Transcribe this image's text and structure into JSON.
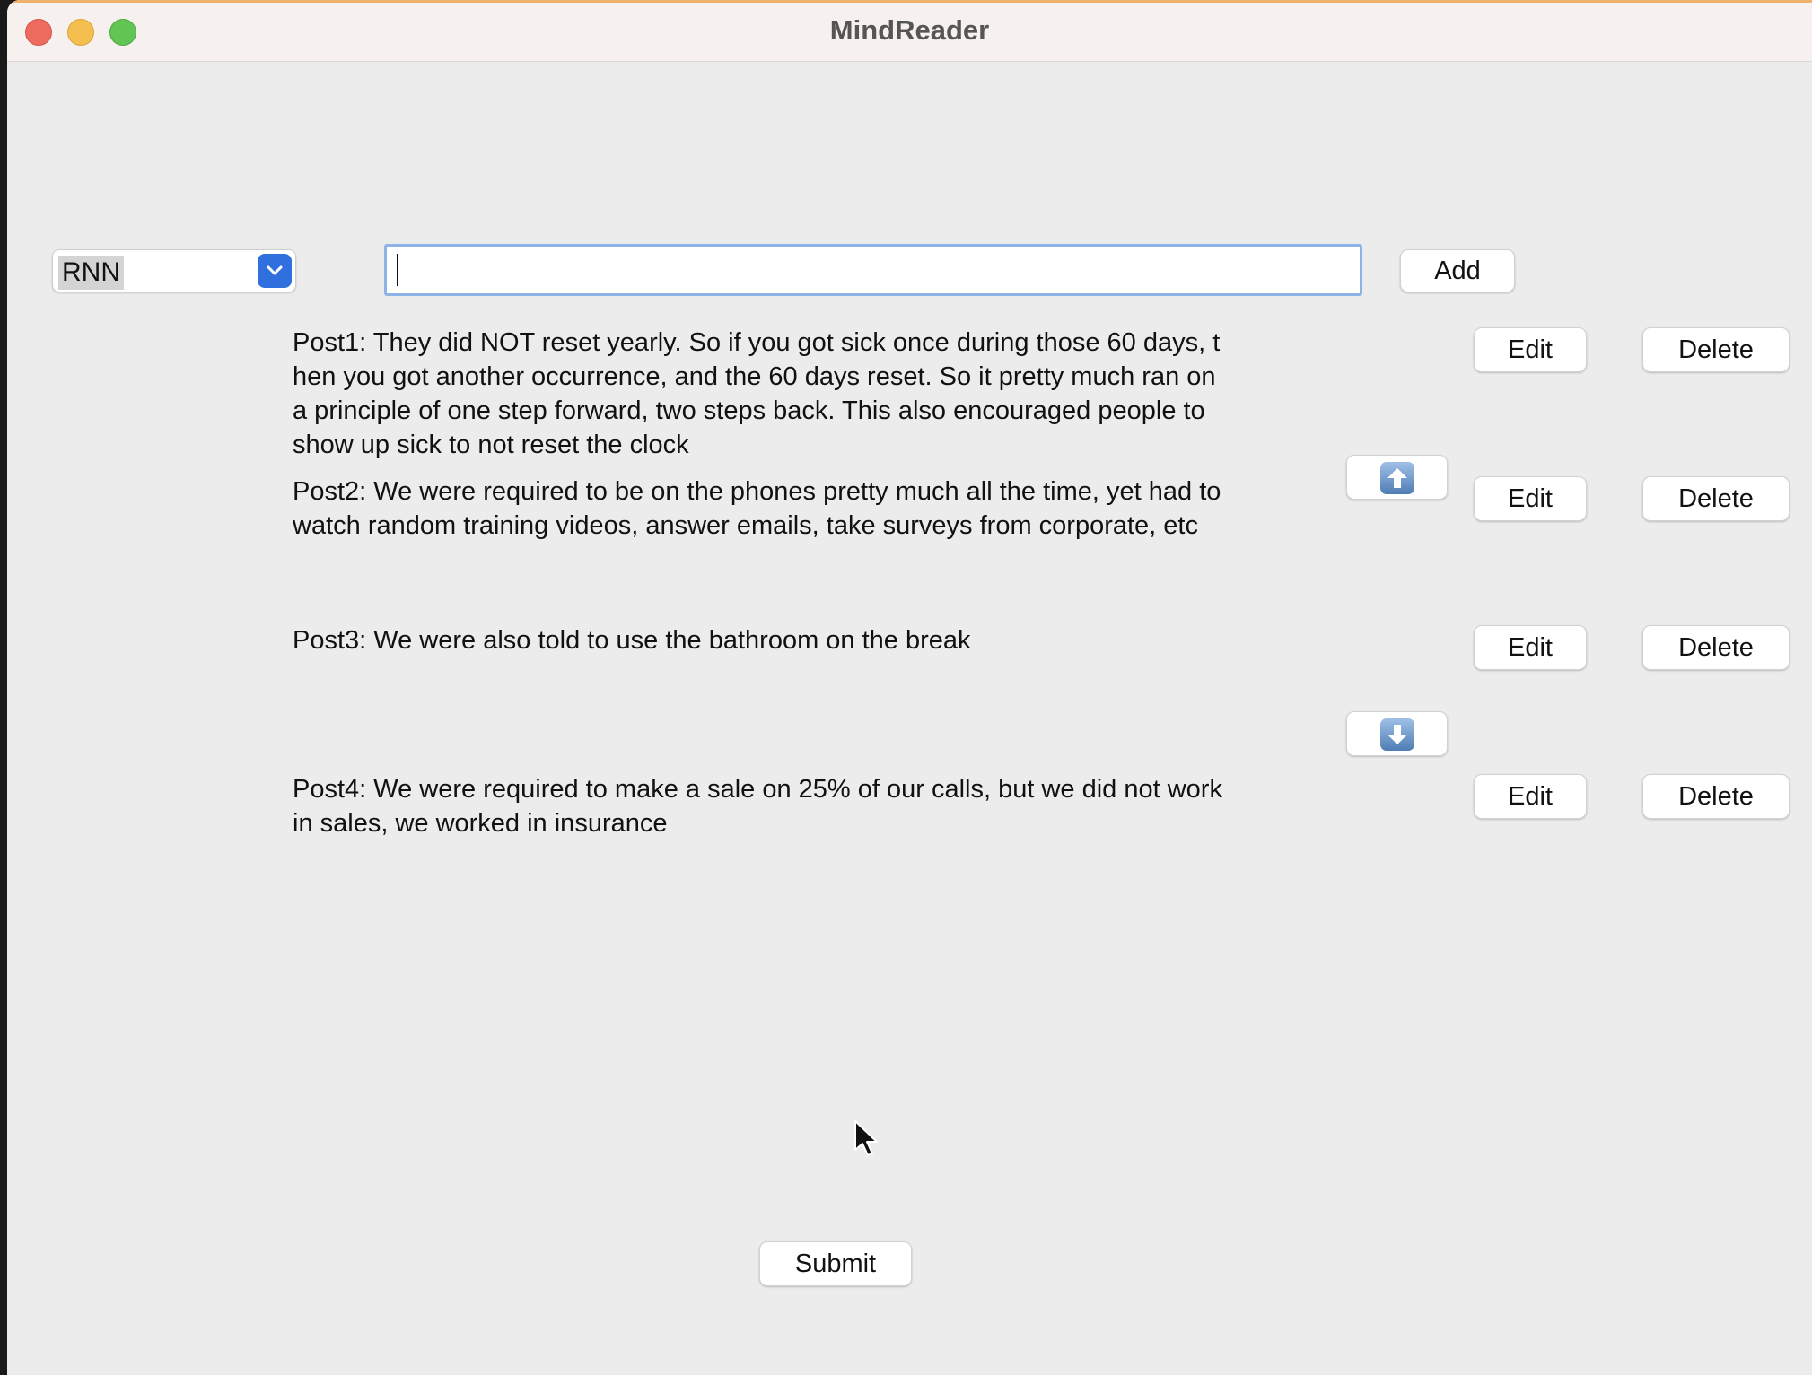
{
  "window": {
    "title": "MindReader"
  },
  "toolbar": {
    "model_select": {
      "selected": "RNN"
    },
    "post_input": {
      "value": "",
      "placeholder": ""
    },
    "add_label": "Add"
  },
  "posts": [
    {
      "text": "Post1: They did NOT reset yearly. So if you got sick once during those 60 days, t\nhen you got another occurrence, and the 60 days reset. So it pretty much ran on\na principle of one step forward, two steps back. This also encouraged people to\nshow up sick to not reset the clock",
      "edit_label": "Edit",
      "delete_label": "Delete"
    },
    {
      "text": "Post2: We were required to be on the phones pretty much all the time, yet had to\nwatch random training videos, answer emails, take surveys from corporate, etc",
      "edit_label": "Edit",
      "delete_label": "Delete"
    },
    {
      "text": "Post3: We were also told to use the bathroom on the break",
      "edit_label": "Edit",
      "delete_label": "Delete"
    },
    {
      "text": "Post4: We were required to make a sale on 25% of our calls, but we did not work\nin sales, we worked in insurance",
      "edit_label": "Edit",
      "delete_label": "Delete"
    }
  ],
  "move_buttons": {
    "up_icon": "arrow-up-icon",
    "down_icon": "arrow-down-icon"
  },
  "submit_label": "Submit",
  "colors": {
    "window_bg": "#ececec",
    "select_accent": "#2f6fde",
    "input_focus_border": "#8fb2e8"
  }
}
